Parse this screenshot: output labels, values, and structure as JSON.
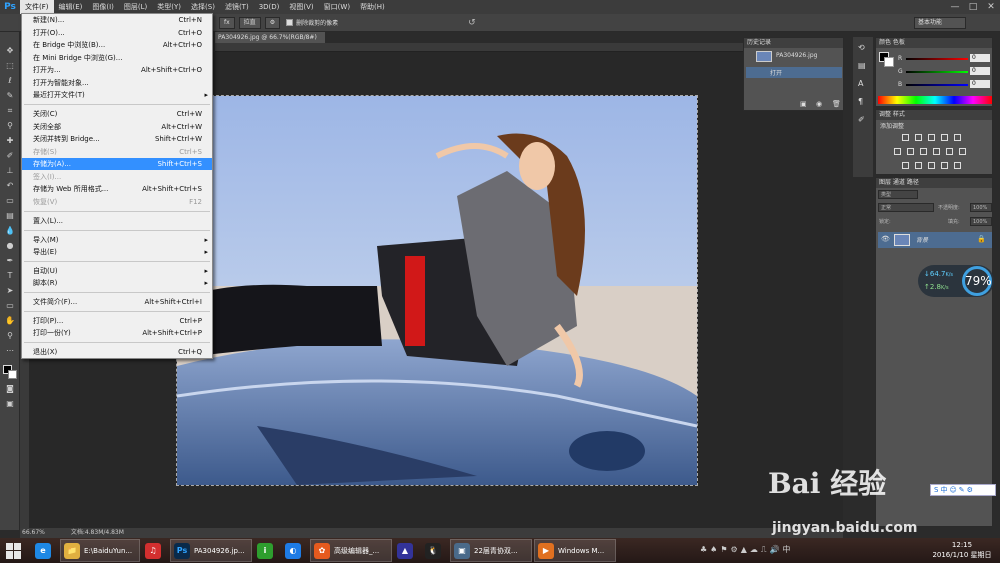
{
  "app": {
    "logo": "Ps"
  },
  "menubar": {
    "items": [
      "文件(F)",
      "编辑(E)",
      "图像(I)",
      "图层(L)",
      "类型(Y)",
      "选择(S)",
      "滤镜(T)",
      "3D(D)",
      "视图(V)",
      "窗口(W)",
      "帮助(H)"
    ],
    "window_buttons": [
      "—",
      "□",
      "✕"
    ]
  },
  "options_bar": {
    "btn1": "fx",
    "btn2": "拉直",
    "checkbox_label": "删除裁剪的像素",
    "workspace": "基本功能"
  },
  "document": {
    "tab_label": "PA304926.jpg @ 66.7%(RGB/8#)",
    "zoom": "66.67%",
    "doc_size": "文档:4.83M/4.83M"
  },
  "file_menu": {
    "items": [
      {
        "label": "新建(N)...",
        "shortcut": "Ctrl+N"
      },
      {
        "label": "打开(O)...",
        "shortcut": "Ctrl+O"
      },
      {
        "label": "在 Bridge 中浏览(B)...",
        "shortcut": "Alt+Ctrl+O"
      },
      {
        "label": "在 Mini Bridge 中浏览(G)...",
        "shortcut": ""
      },
      {
        "label": "打开为...",
        "shortcut": "Alt+Shift+Ctrl+O"
      },
      {
        "label": "打开为智能对象...",
        "shortcut": ""
      },
      {
        "label": "最近打开文件(T)",
        "shortcut": "",
        "submenu": "▸"
      },
      {
        "label": "关闭(C)",
        "shortcut": "Ctrl+W"
      },
      {
        "label": "关闭全部",
        "shortcut": "Alt+Ctrl+W"
      },
      {
        "label": "关闭并转到 Bridge...",
        "shortcut": "Shift+Ctrl+W"
      },
      {
        "label": "存储(S)",
        "shortcut": "Ctrl+S"
      },
      {
        "label": "存储为(A)...",
        "shortcut": "Shift+Ctrl+S"
      },
      {
        "label": "签入(I)...",
        "shortcut": ""
      },
      {
        "label": "存储为 Web 所用格式...",
        "shortcut": "Alt+Shift+Ctrl+S"
      },
      {
        "label": "恢复(V)",
        "shortcut": "F12"
      },
      {
        "label": "置入(L)...",
        "shortcut": ""
      },
      {
        "label": "导入(M)",
        "shortcut": "",
        "submenu": "▸"
      },
      {
        "label": "导出(E)",
        "shortcut": "",
        "submenu": "▸"
      },
      {
        "label": "自动(U)",
        "shortcut": "",
        "submenu": "▸"
      },
      {
        "label": "脚本(R)",
        "shortcut": "",
        "submenu": "▸"
      },
      {
        "label": "文件简介(F)...",
        "shortcut": "Alt+Shift+Ctrl+I"
      },
      {
        "label": "打印(P)...",
        "shortcut": "Ctrl+P"
      },
      {
        "label": "打印一份(Y)",
        "shortcut": "Alt+Shift+Ctrl+P"
      },
      {
        "label": "退出(X)",
        "shortcut": "Ctrl+Q"
      }
    ]
  },
  "history_panel": {
    "tab": "历史记录",
    "snapshot": "PA304926.jpg",
    "step": "打开"
  },
  "color_panel": {
    "tabs": "颜色  色板",
    "channels": [
      {
        "label": "R",
        "value": "0",
        "color": "#e04040"
      },
      {
        "label": "G",
        "value": "0",
        "color": "#40c040"
      },
      {
        "label": "B",
        "value": "0",
        "color": "#4060e0"
      }
    ]
  },
  "adjustments_panel": {
    "tabs": "调整  样式",
    "title": "添加调整"
  },
  "layers_panel": {
    "tabs": "图层  通道  路径",
    "kind": "类型",
    "blend_mode": "正常",
    "opacity_label": "不透明度:",
    "opacity_value": "100%",
    "lock_label": "锁定:",
    "fill_label": "填充:",
    "fill_value": "100%",
    "layer_name": "背景"
  },
  "net_monitor": {
    "down": "64.7",
    "up": "2.8",
    "unit": "K/s",
    "percent": "79%"
  },
  "watermark": {
    "logo": "Bai 经验",
    "url": "jingyan.baidu.com"
  },
  "ime_bar": "S中☺✎⚙",
  "taskbar": {
    "items": [
      {
        "label": "",
        "icon": "e",
        "color": "#1e88e5"
      },
      {
        "label": "E:\\BaiduYun...",
        "icon": "📁",
        "color": "#e0b040"
      },
      {
        "label": "",
        "icon": "♫",
        "color": "#d32f2f"
      },
      {
        "label": "PA304926.jp...",
        "icon": "Ps",
        "color": "#0a2a4a"
      },
      {
        "label": "",
        "icon": "i",
        "color": "#2e9e2e"
      },
      {
        "label": "",
        "icon": "◐",
        "color": "#1e7be5"
      },
      {
        "label": "高级编辑器_...",
        "icon": "✿",
        "color": "#e55a1e"
      },
      {
        "label": "",
        "icon": "▲",
        "color": "#333399"
      },
      {
        "label": "",
        "icon": "🐧",
        "color": "#222"
      },
      {
        "label": "22届青协双...",
        "icon": "▣",
        "color": "#4a6a8a"
      },
      {
        "label": "Windows M...",
        "icon": "▶",
        "color": "#e07020"
      }
    ],
    "time": "12:15",
    "date": "2016/1/10 星期日"
  }
}
